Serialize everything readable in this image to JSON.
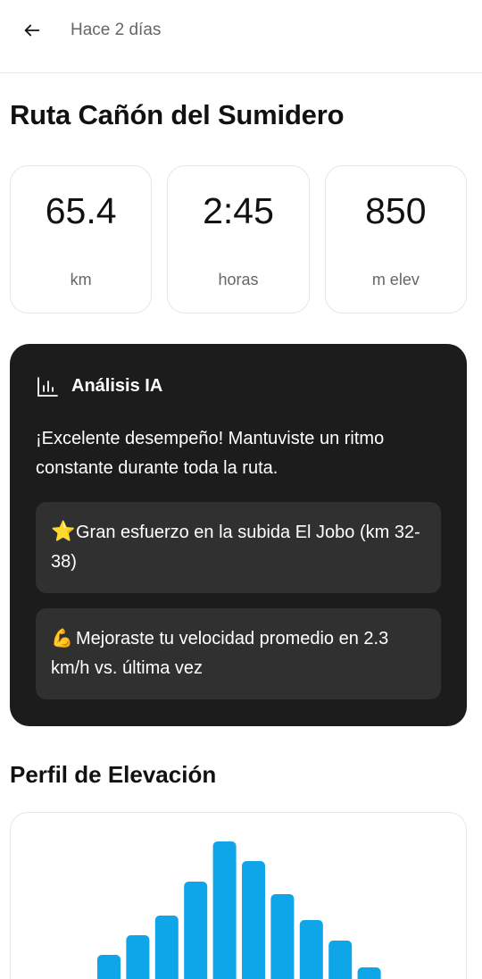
{
  "header": {
    "title": "Hace 2 días"
  },
  "route": {
    "title": "Ruta Cañón del Sumidero"
  },
  "stats": [
    {
      "value": "65.4",
      "unit": "km"
    },
    {
      "value": "2:45",
      "unit": "horas"
    },
    {
      "value": "850",
      "unit": "m elev"
    }
  ],
  "ai": {
    "icon": "bar-chart-icon",
    "title": "Análisis IA",
    "summary": "¡Excelente desempeño! Mantuviste un ritmo constante durante toda la ruta.",
    "insights": [
      {
        "icon": "star-emoji",
        "emoji": "⭐",
        "text": "Gran esfuerzo en la subida El Jobo (km 32-38)"
      },
      {
        "icon": "flexed-biceps-emoji",
        "emoji": "💪",
        "text": "Mejoraste tu velocidad promedio en 2.3 km/h vs. última vez"
      }
    ]
  },
  "elevation": {
    "title": "Perfil de Elevación"
  },
  "colors": {
    "bar": "#0ea5e9",
    "dark_card": "#1c1c1c",
    "insight_bg": "#303030"
  },
  "chart_data": {
    "type": "bar",
    "title": "Perfil de Elevación",
    "values": [
      28,
      50,
      72,
      110,
      155,
      133,
      96,
      67,
      44,
      14
    ],
    "ylim": [
      0,
      160
    ],
    "grid": false,
    "legend": "none"
  }
}
